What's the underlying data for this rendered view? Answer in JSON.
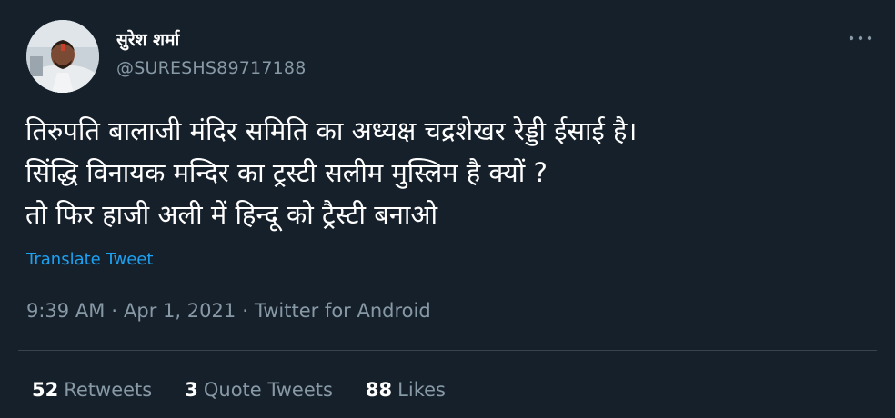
{
  "author": {
    "display_name": "सुरेश शर्मा",
    "handle": "@SURESHS89717188"
  },
  "icons": {
    "more": "more-options-icon",
    "avatar": "profile-avatar"
  },
  "tweet": {
    "lines": [
      "तिरुपति बालाजी मंदिर समिति का अध्यक्ष चद्रशेखर रेड्डी ईसाई है।",
      "सिंद्धि विनायक मन्दिर का ट्रस्टी सलीम मुस्लिम है क्यों ?",
      "तो फिर हाजी अली में हिन्दू को ट्रैस्टी बनाओ"
    ],
    "translate_label": "Translate Tweet"
  },
  "meta": {
    "time": "9:39 AM",
    "date": "Apr 1, 2021",
    "source": "Twitter for Android",
    "separator": "·"
  },
  "stats": {
    "retweets": {
      "count": "52",
      "label": "Retweets"
    },
    "quotes": {
      "count": "3",
      "label": "Quote Tweets"
    },
    "likes": {
      "count": "88",
      "label": "Likes"
    }
  },
  "colors": {
    "background": "#15202b",
    "text": "#ffffff",
    "secondary": "#8899a6",
    "link": "#1da1f2",
    "divider": "#38444d"
  }
}
